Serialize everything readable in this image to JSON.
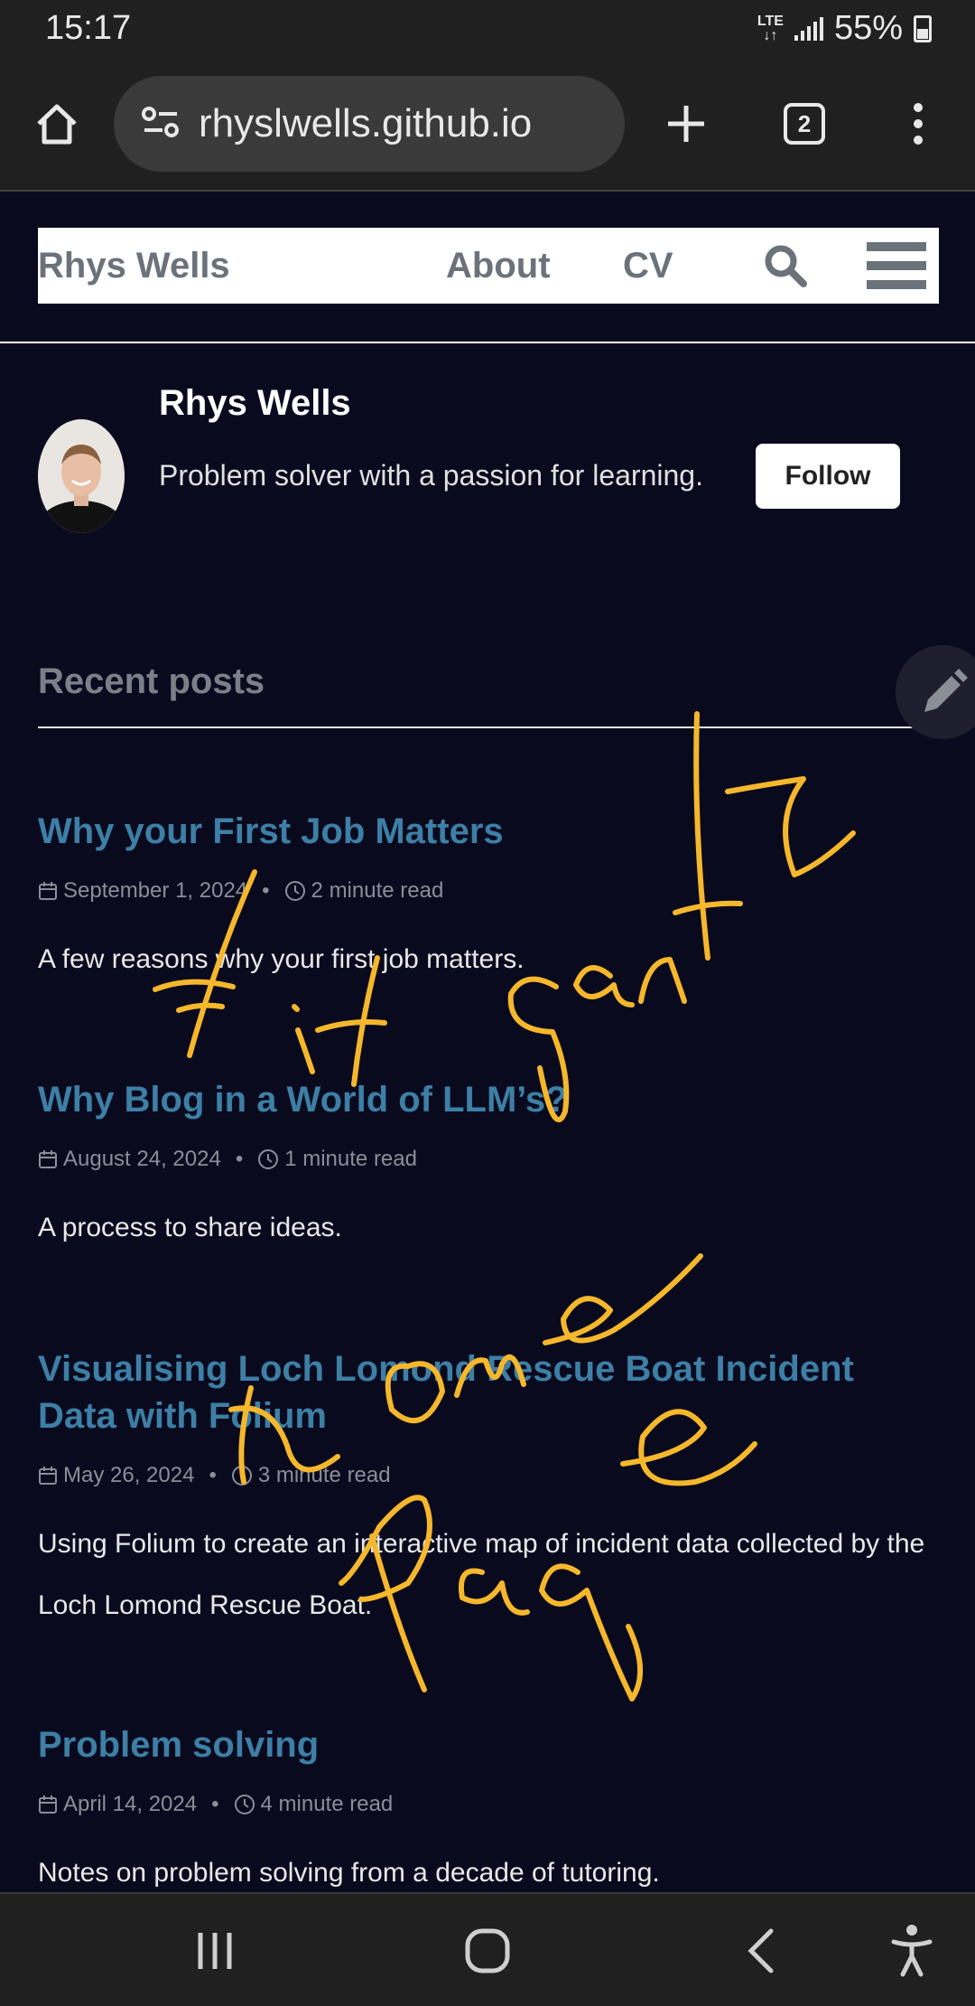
{
  "status_bar": {
    "time": "15:17",
    "network": "LTE",
    "battery": "55%"
  },
  "browser": {
    "url": "rhyslwells.github.io",
    "tab_count": "2"
  },
  "site": {
    "title": "Rhys Wells",
    "nav": {
      "about": "About",
      "cv": "CV"
    }
  },
  "author": {
    "name": "Rhys Wells",
    "bio": "Problem solver with a passion for learning.",
    "follow_label": "Follow"
  },
  "recent_posts_heading": "Recent posts",
  "posts": [
    {
      "title": "Why your First Job Matters",
      "date": "September 1, 2024",
      "read_time": "2 minute read",
      "excerpt": "A few reasons why your first job matters."
    },
    {
      "title": "Why Blog in a World of LLM’s?",
      "date": "August 24, 2024",
      "read_time": "1 minute read",
      "excerpt": "A process to share ideas."
    },
    {
      "title": "Visualising Loch Lomond Rescue Boat Incident Data with Folium",
      "date": "May 26, 2024",
      "read_time": "3 minute read",
      "excerpt": "Using Folium to create an interactive map of incident data collected by the Loch Lomond Rescue Boat."
    },
    {
      "title": "Problem solving",
      "date": "April 14, 2024",
      "read_time": "4 minute read",
      "excerpt": "Notes on problem solving from a decade of tutoring."
    }
  ],
  "handwriting": {
    "color": "#f5b72b",
    "text": "Fit Gantz home page"
  },
  "icons": [
    "home-icon",
    "site-settings-icon",
    "new-tab-icon",
    "tabs-icon",
    "more-icon",
    "search-icon",
    "menu-icon",
    "edit-icon",
    "calendar-icon",
    "clock-icon",
    "recent-apps-icon",
    "home-button-icon",
    "back-icon",
    "accessibility-icon"
  ]
}
